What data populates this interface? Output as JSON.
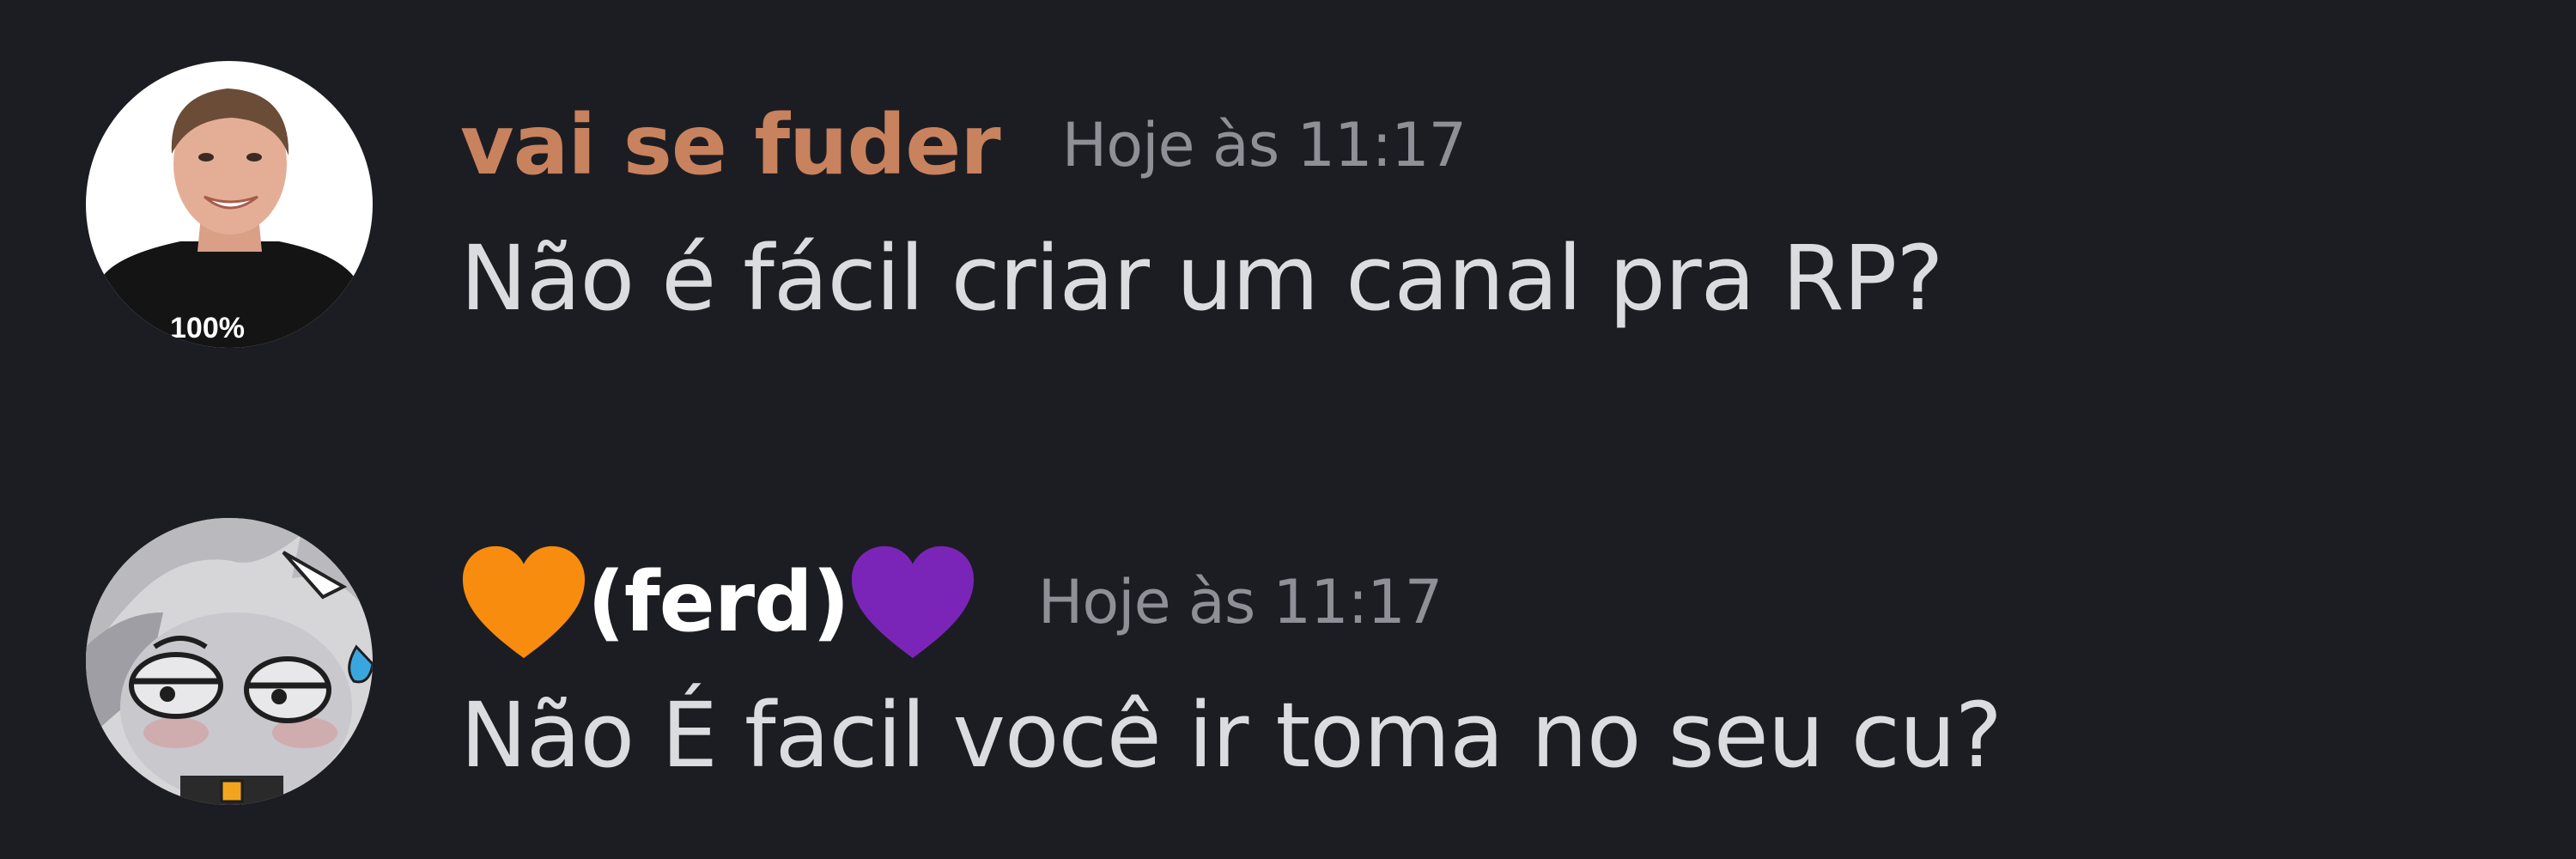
{
  "messages": [
    {
      "author": "vai se fuder",
      "author_color": "#c8825e",
      "timestamp": "Hoje às 11:17",
      "content": "Não é fácil criar um canal pra RP?",
      "avatar": {
        "kind": "photo-man-black-shirt",
        "shirt_text": "100%"
      }
    },
    {
      "author_prefix_icon": "orange-heart-icon",
      "author": "(ferd)",
      "author_suffix_icon": "purple-heart-icon",
      "author_color": "#ffffff",
      "timestamp": "Hoje às 11:17",
      "content": "Não É facil você ir toma no seu cu?",
      "avatar": {
        "kind": "cartoon-gray-character"
      }
    }
  ],
  "colors": {
    "background": "#1c1d22",
    "timestamp": "#8f9097",
    "message_text": "#dbdcdf",
    "orange_heart": "#f78c0e",
    "purple_heart": "#7b25b8"
  }
}
